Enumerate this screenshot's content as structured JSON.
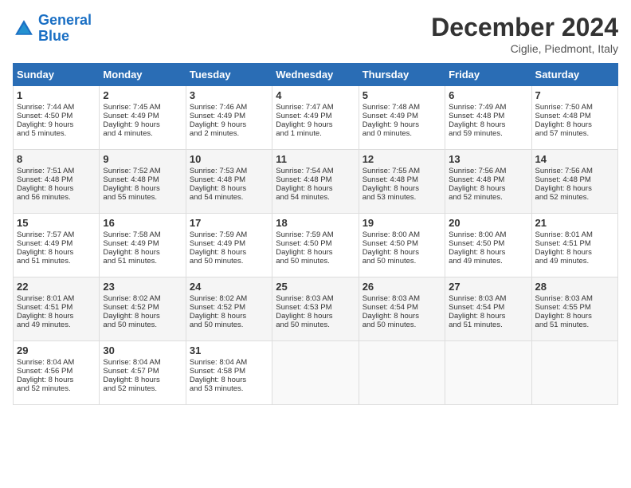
{
  "header": {
    "logo_general": "General",
    "logo_blue": "Blue",
    "title": "December 2024",
    "location": "Ciglie, Piedmont, Italy"
  },
  "days_of_week": [
    "Sunday",
    "Monday",
    "Tuesday",
    "Wednesday",
    "Thursday",
    "Friday",
    "Saturday"
  ],
  "weeks": [
    [
      {
        "day": "1",
        "lines": [
          "Sunrise: 7:44 AM",
          "Sunset: 4:50 PM",
          "Daylight: 9 hours",
          "and 5 minutes."
        ]
      },
      {
        "day": "2",
        "lines": [
          "Sunrise: 7:45 AM",
          "Sunset: 4:49 PM",
          "Daylight: 9 hours",
          "and 4 minutes."
        ]
      },
      {
        "day": "3",
        "lines": [
          "Sunrise: 7:46 AM",
          "Sunset: 4:49 PM",
          "Daylight: 9 hours",
          "and 2 minutes."
        ]
      },
      {
        "day": "4",
        "lines": [
          "Sunrise: 7:47 AM",
          "Sunset: 4:49 PM",
          "Daylight: 9 hours",
          "and 1 minute."
        ]
      },
      {
        "day": "5",
        "lines": [
          "Sunrise: 7:48 AM",
          "Sunset: 4:49 PM",
          "Daylight: 9 hours",
          "and 0 minutes."
        ]
      },
      {
        "day": "6",
        "lines": [
          "Sunrise: 7:49 AM",
          "Sunset: 4:48 PM",
          "Daylight: 8 hours",
          "and 59 minutes."
        ]
      },
      {
        "day": "7",
        "lines": [
          "Sunrise: 7:50 AM",
          "Sunset: 4:48 PM",
          "Daylight: 8 hours",
          "and 57 minutes."
        ]
      }
    ],
    [
      {
        "day": "8",
        "lines": [
          "Sunrise: 7:51 AM",
          "Sunset: 4:48 PM",
          "Daylight: 8 hours",
          "and 56 minutes."
        ]
      },
      {
        "day": "9",
        "lines": [
          "Sunrise: 7:52 AM",
          "Sunset: 4:48 PM",
          "Daylight: 8 hours",
          "and 55 minutes."
        ]
      },
      {
        "day": "10",
        "lines": [
          "Sunrise: 7:53 AM",
          "Sunset: 4:48 PM",
          "Daylight: 8 hours",
          "and 54 minutes."
        ]
      },
      {
        "day": "11",
        "lines": [
          "Sunrise: 7:54 AM",
          "Sunset: 4:48 PM",
          "Daylight: 8 hours",
          "and 54 minutes."
        ]
      },
      {
        "day": "12",
        "lines": [
          "Sunrise: 7:55 AM",
          "Sunset: 4:48 PM",
          "Daylight: 8 hours",
          "and 53 minutes."
        ]
      },
      {
        "day": "13",
        "lines": [
          "Sunrise: 7:56 AM",
          "Sunset: 4:48 PM",
          "Daylight: 8 hours",
          "and 52 minutes."
        ]
      },
      {
        "day": "14",
        "lines": [
          "Sunrise: 7:56 AM",
          "Sunset: 4:48 PM",
          "Daylight: 8 hours",
          "and 52 minutes."
        ]
      }
    ],
    [
      {
        "day": "15",
        "lines": [
          "Sunrise: 7:57 AM",
          "Sunset: 4:49 PM",
          "Daylight: 8 hours",
          "and 51 minutes."
        ]
      },
      {
        "day": "16",
        "lines": [
          "Sunrise: 7:58 AM",
          "Sunset: 4:49 PM",
          "Daylight: 8 hours",
          "and 51 minutes."
        ]
      },
      {
        "day": "17",
        "lines": [
          "Sunrise: 7:59 AM",
          "Sunset: 4:49 PM",
          "Daylight: 8 hours",
          "and 50 minutes."
        ]
      },
      {
        "day": "18",
        "lines": [
          "Sunrise: 7:59 AM",
          "Sunset: 4:50 PM",
          "Daylight: 8 hours",
          "and 50 minutes."
        ]
      },
      {
        "day": "19",
        "lines": [
          "Sunrise: 8:00 AM",
          "Sunset: 4:50 PM",
          "Daylight: 8 hours",
          "and 50 minutes."
        ]
      },
      {
        "day": "20",
        "lines": [
          "Sunrise: 8:00 AM",
          "Sunset: 4:50 PM",
          "Daylight: 8 hours",
          "and 49 minutes."
        ]
      },
      {
        "day": "21",
        "lines": [
          "Sunrise: 8:01 AM",
          "Sunset: 4:51 PM",
          "Daylight: 8 hours",
          "and 49 minutes."
        ]
      }
    ],
    [
      {
        "day": "22",
        "lines": [
          "Sunrise: 8:01 AM",
          "Sunset: 4:51 PM",
          "Daylight: 8 hours",
          "and 49 minutes."
        ]
      },
      {
        "day": "23",
        "lines": [
          "Sunrise: 8:02 AM",
          "Sunset: 4:52 PM",
          "Daylight: 8 hours",
          "and 50 minutes."
        ]
      },
      {
        "day": "24",
        "lines": [
          "Sunrise: 8:02 AM",
          "Sunset: 4:52 PM",
          "Daylight: 8 hours",
          "and 50 minutes."
        ]
      },
      {
        "day": "25",
        "lines": [
          "Sunrise: 8:03 AM",
          "Sunset: 4:53 PM",
          "Daylight: 8 hours",
          "and 50 minutes."
        ]
      },
      {
        "day": "26",
        "lines": [
          "Sunrise: 8:03 AM",
          "Sunset: 4:54 PM",
          "Daylight: 8 hours",
          "and 50 minutes."
        ]
      },
      {
        "day": "27",
        "lines": [
          "Sunrise: 8:03 AM",
          "Sunset: 4:54 PM",
          "Daylight: 8 hours",
          "and 51 minutes."
        ]
      },
      {
        "day": "28",
        "lines": [
          "Sunrise: 8:03 AM",
          "Sunset: 4:55 PM",
          "Daylight: 8 hours",
          "and 51 minutes."
        ]
      }
    ],
    [
      {
        "day": "29",
        "lines": [
          "Sunrise: 8:04 AM",
          "Sunset: 4:56 PM",
          "Daylight: 8 hours",
          "and 52 minutes."
        ]
      },
      {
        "day": "30",
        "lines": [
          "Sunrise: 8:04 AM",
          "Sunset: 4:57 PM",
          "Daylight: 8 hours",
          "and 52 minutes."
        ]
      },
      {
        "day": "31",
        "lines": [
          "Sunrise: 8:04 AM",
          "Sunset: 4:58 PM",
          "Daylight: 8 hours",
          "and 53 minutes."
        ]
      },
      {
        "day": "",
        "lines": []
      },
      {
        "day": "",
        "lines": []
      },
      {
        "day": "",
        "lines": []
      },
      {
        "day": "",
        "lines": []
      }
    ]
  ]
}
